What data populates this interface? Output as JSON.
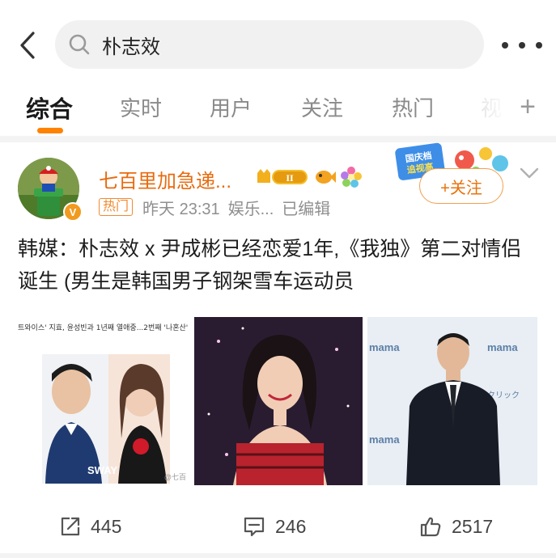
{
  "search": {
    "query": "朴志效"
  },
  "tabs": [
    {
      "label": "综合",
      "active": true
    },
    {
      "label": "实时"
    },
    {
      "label": "用户"
    },
    {
      "label": "关注"
    },
    {
      "label": "热门"
    }
  ],
  "post": {
    "username": "七百里加急递...",
    "level_badge": "II",
    "tag": "热门",
    "time": "昨天 23:31",
    "source": "娱乐...",
    "edited": "已编辑",
    "follow_label": "+关注",
    "promo_text": "国庆档 追视高",
    "text": "韩媒：朴志效 x 尹成彬已经恋爱1年,《我独》第二对情侣诞生 (男生是韩国男子钢架雪车运动员",
    "image1_headline": "트와이스' 지효, 윤성빈과 1년째 열애중...2번째 '나혼산' 커플 탄",
    "image1_label": "SWAY",
    "image1_watermark": "@七百",
    "actions": {
      "repost_count": "445",
      "comment_count": "246",
      "like_count": "2517"
    }
  },
  "colors": {
    "accent": "#ff8200",
    "username": "#e86b0f",
    "muted": "#8f8f8f"
  }
}
